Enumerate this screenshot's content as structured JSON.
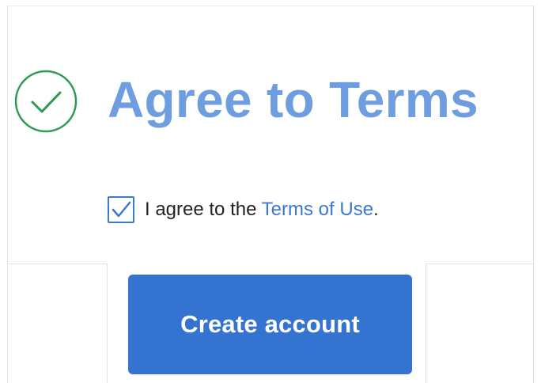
{
  "header": {
    "title": "Agree to Terms",
    "status_icon": "check-circle-icon",
    "status_color": "#2e9a52"
  },
  "agreement": {
    "checked": true,
    "checkbox_icon": "checkmark-icon",
    "text_before": "I agree to the ",
    "link_text": "Terms of Use",
    "text_after": "."
  },
  "actions": {
    "create_account_label": "Create account"
  },
  "colors": {
    "title": "#6f9ee0",
    "accent": "#3b78d4",
    "button": "#3474d0",
    "success": "#2e9a52"
  }
}
